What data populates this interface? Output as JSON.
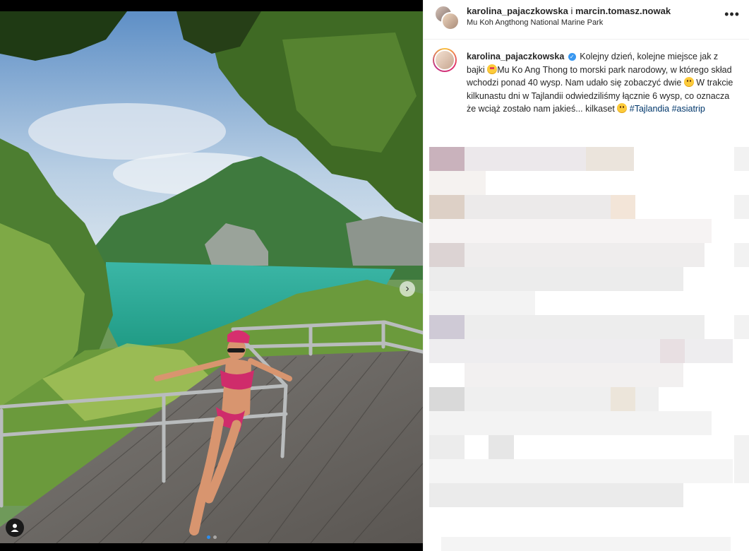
{
  "post": {
    "header": {
      "user1": "karolina_pajaczkowska",
      "separator": "i",
      "user2": "marcin.tomasz.nowak",
      "location": "Mu Koh Angthong National Marine Park"
    },
    "caption": {
      "username": "karolina_pajaczkowska",
      "text_1": "Kolejny dzień, kolejne miejsce jak z bajki",
      "text_2": "Mu Ko Ang Thong to morski park narodowy, w którego skład wchodzi ponad 40 wysp. Nam udało się zobaczyć dwie",
      "text_3": "W trakcie kilkunastu dni w Tajlandii odwiedziliśmy łącznie 6 wysp, co oznacza że wciąż zostało nam jakieś... kilkaset",
      "hashtags": [
        "#Tajlandia",
        "#asiatrip"
      ]
    },
    "icons": {
      "more": "more-options-icon",
      "carousel": "chevron-right-icon",
      "tag": "user-tag-icon",
      "verified": "verified-badge-icon"
    },
    "colors": {
      "accent_blue": "#3897f0",
      "hashtag": "#00376b",
      "text": "#262626"
    }
  }
}
